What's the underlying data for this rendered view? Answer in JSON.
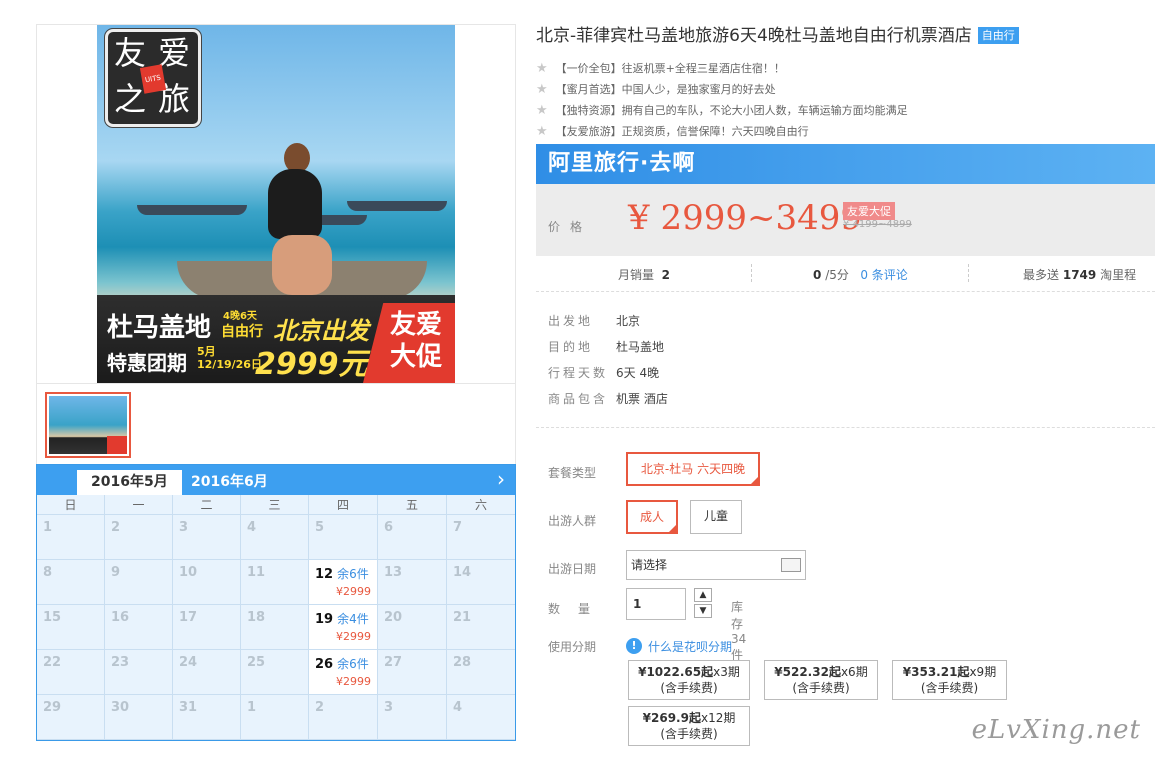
{
  "product": {
    "title": "北京-菲律宾杜马盖地旅游6天4晚杜马盖地自由行机票酒店",
    "badge": "自由行",
    "features": [
      {
        "tag": "【一价全包】",
        "text": "往返机票+全程三星酒店住宿！！"
      },
      {
        "tag": "【蜜月首选】",
        "text": "中国人少，是独家蜜月的好去处"
      },
      {
        "tag": "【独特资源】",
        "text": "拥有自己的车队，不论大小团人数，车辆运输方面均能满足"
      },
      {
        "tag": "【友爱旅游】",
        "text": "正规资质，信誉保障！六天四晚自由行"
      }
    ]
  },
  "image": {
    "logo_chars": [
      "友",
      "爱",
      "之",
      "旅"
    ],
    "logo_sub": "UITS",
    "banner_line1": "杜马盖地",
    "banner_tag": "4晚6天",
    "banner_free": "自由行",
    "banner_depart": "北京出发",
    "banner_line2": "特惠团期",
    "banner_dates": [
      "5月",
      "12/19/26日"
    ],
    "banner_price": "2999元",
    "banner_promo": [
      "友爱",
      "大促"
    ]
  },
  "brand": {
    "name": "阿里旅行·去啊",
    "price_label": "价格",
    "price": "¥ 2999~3499",
    "promo_tag": "友爱大促",
    "old_price": "¥ 4199~4899"
  },
  "stats": {
    "sales_label": "月销量",
    "sales": "2",
    "rating": "0",
    "rating_suffix": "/5分",
    "reviews": "0 条评论",
    "points_label": "最多送",
    "points": "1749",
    "points_suffix": "淘里程"
  },
  "info": [
    {
      "k": "出发地",
      "v": "北京"
    },
    {
      "k": "目的地",
      "v": "杜马盖地"
    },
    {
      "k": "行程天数",
      "v": "6天 4晚"
    },
    {
      "k": "商品包含",
      "v": "机票  酒店"
    }
  ],
  "options": {
    "package_label": "套餐类型",
    "package_value": "北京-杜马 六天四晚",
    "people_label": "出游人群",
    "people_adult": "成人",
    "people_child": "儿童",
    "date_label": "出游日期",
    "date_placeholder": "请选择",
    "qty_label": "数量",
    "qty_value": "1",
    "stock": "库存34 件",
    "installment_label": "使用分期",
    "installment_help": "什么是花呗分期",
    "installments": [
      {
        "amount": "¥1022.65起",
        "period": "x3期",
        "note": "(含手续费)"
      },
      {
        "amount": "¥522.32起",
        "period": "x6期",
        "note": "(含手续费)"
      },
      {
        "amount": "¥353.21起",
        "period": "x9期",
        "note": "(含手续费)"
      },
      {
        "amount": "¥269.9起",
        "period": "x12期",
        "note": "(含手续费)"
      }
    ]
  },
  "calendar": {
    "tabs": [
      "2016年5月",
      "2016年6月"
    ],
    "next": "›",
    "weekdays": [
      "日",
      "一",
      "二",
      "三",
      "四",
      "五",
      "六"
    ],
    "cells": [
      {
        "d": "1"
      },
      {
        "d": "2"
      },
      {
        "d": "3"
      },
      {
        "d": "4"
      },
      {
        "d": "5"
      },
      {
        "d": "6"
      },
      {
        "d": "7"
      },
      {
        "d": "8"
      },
      {
        "d": "9"
      },
      {
        "d": "10"
      },
      {
        "d": "11"
      },
      {
        "d": "12",
        "stock": "余6件",
        "price": "¥2999"
      },
      {
        "d": "13"
      },
      {
        "d": "14"
      },
      {
        "d": "15"
      },
      {
        "d": "16"
      },
      {
        "d": "17"
      },
      {
        "d": "18"
      },
      {
        "d": "19",
        "stock": "余4件",
        "price": "¥2999"
      },
      {
        "d": "20"
      },
      {
        "d": "21"
      },
      {
        "d": "22"
      },
      {
        "d": "23"
      },
      {
        "d": "24"
      },
      {
        "d": "25"
      },
      {
        "d": "26",
        "stock": "余6件",
        "price": "¥2999"
      },
      {
        "d": "27"
      },
      {
        "d": "28"
      },
      {
        "d": "29"
      },
      {
        "d": "30"
      },
      {
        "d": "31"
      },
      {
        "d": "1"
      },
      {
        "d": "2"
      },
      {
        "d": "3"
      },
      {
        "d": "4"
      }
    ]
  },
  "watermark": "eLvXing.net"
}
